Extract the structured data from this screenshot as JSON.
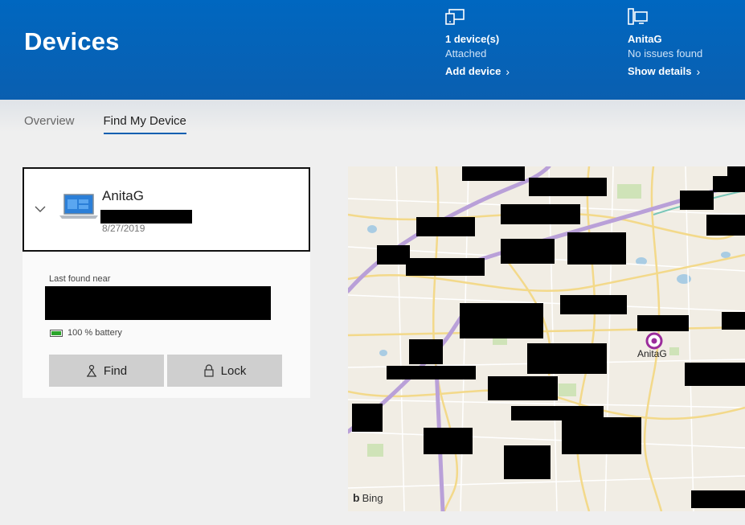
{
  "header": {
    "title": "Devices",
    "stats": [
      {
        "primary": "1 device(s)",
        "secondary": "Attached",
        "link": "Add device",
        "icon": "devices-icon"
      },
      {
        "primary": "AnitaG",
        "secondary": "No issues found",
        "link": "Show details",
        "icon": "pc-status-icon"
      }
    ]
  },
  "tabs": [
    {
      "label": "Overview",
      "active": false
    },
    {
      "label": "Find My Device",
      "active": true
    }
  ],
  "device": {
    "name": "AnitaG",
    "date": "8/27/2019",
    "last_found_label": "Last found near",
    "battery_text": "100 % battery",
    "find_label": "Find",
    "lock_label": "Lock"
  },
  "map": {
    "pin_label": "AnitaG",
    "provider": "Bing"
  },
  "colors": {
    "banner": "#0067c0",
    "accent": "#0a5fb0",
    "pin": "#9b2c9b",
    "highway": "#b9a0d8",
    "road": "#f3d98a"
  }
}
